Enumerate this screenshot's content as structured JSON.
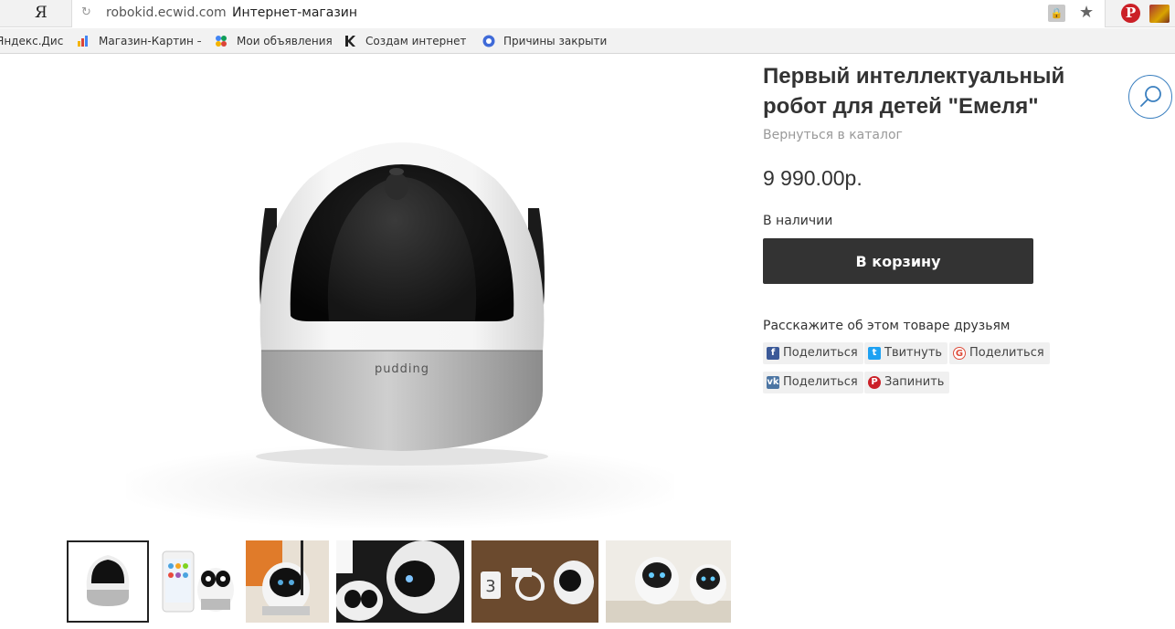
{
  "browser": {
    "logo": "Я",
    "url_domain": "robokid.ecwid.com",
    "url_title": "Интернет-магазин",
    "bookmarks": [
      {
        "label": "Яндекс.Диск"
      },
      {
        "label": "Магазин-Картин –"
      },
      {
        "label": "Мои объявления"
      },
      {
        "label": "Создам интернет-"
      },
      {
        "label": "Причины закрыти"
      }
    ]
  },
  "product": {
    "title": "Первый интеллектуальный робот для детей \"Емеля\"",
    "back_link": "Вернуться в каталог",
    "price": "9 990.00р.",
    "stock": "В наличии",
    "cart_button": "В корзину",
    "brand_on_robot": "pudding"
  },
  "share": {
    "title": "Расскажите об этом товаре друзьям",
    "buttons": [
      {
        "label": "Поделиться",
        "icon": "facebook-icon",
        "color": "#3b5998"
      },
      {
        "label": "Твитнуть",
        "icon": "twitter-icon",
        "color": "#1da1f2"
      },
      {
        "label": "Поделиться",
        "icon": "google-icon",
        "color": "#dd4b39"
      },
      {
        "label": "Поделиться",
        "icon": "vk-icon",
        "color": "#4c75a3"
      },
      {
        "label": "Запинить",
        "icon": "pinterest-icon",
        "color": "#cb2027"
      }
    ]
  },
  "colors": {
    "cart_button": "#333333",
    "search_accent": "#3a7fbf"
  }
}
